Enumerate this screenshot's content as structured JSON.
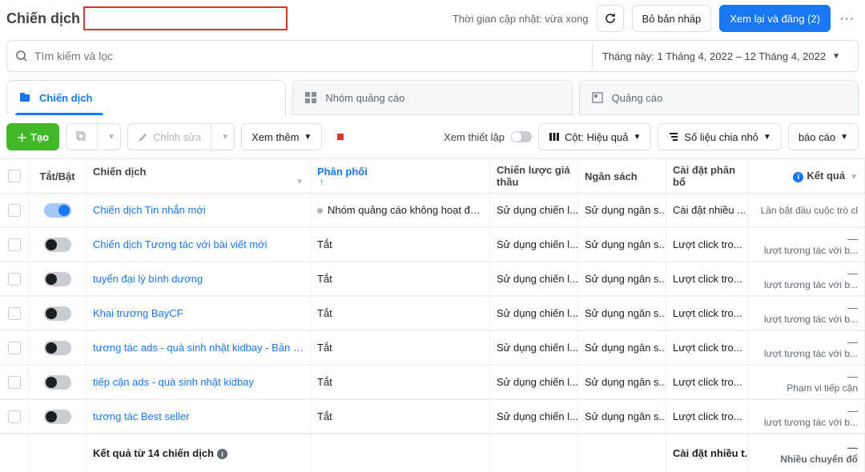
{
  "header": {
    "title": "Chiến dịch",
    "update_text": "Thời gian cập nhật: vừa xong",
    "discard": "Bỏ bản nháp",
    "review": "Xem lại và đăng (2)"
  },
  "search": {
    "placeholder": "Tìm kiếm và lọc",
    "date_range": "Tháng này: 1 Tháng 4, 2022 – 12 Tháng 4, 2022"
  },
  "tabs": {
    "campaigns": "Chiến dịch",
    "adsets": "Nhóm quảng cáo",
    "ads": "Quảng cáo"
  },
  "toolbar": {
    "create": "Tạo",
    "edit": "Chỉnh sửa",
    "more": "Xem thêm",
    "view_setup": "Xem thiết lập",
    "columns": "Cột: Hiệu quả",
    "breakdown": "Số liệu chia nhỏ",
    "reports": "báo cáo"
  },
  "columns": {
    "toggle": "Tắt/Bật",
    "campaign": "Chiến dịch",
    "delivery": "Phân phối",
    "bid": "Chiến lược giá thầu",
    "budget": "Ngân sách",
    "alloc": "Cài đặt phân bổ",
    "results": "Kết quả"
  },
  "rows": [
    {
      "on": true,
      "name": "Chiến dịch Tin nhắn mới",
      "delivery": "Nhóm quảng cáo không hoạt động",
      "dot": true,
      "bid": "Sử dụng chiến l...",
      "budget": "Sử dụng ngân s...",
      "alloc": "Cài đặt nhiều ...",
      "res_main": "",
      "res_sub": "Lần bắt đầu cuộc trò cl"
    },
    {
      "on": false,
      "name": "Chiến dịch Tương tác với bài viết mới",
      "delivery": "Tắt",
      "dot": false,
      "bid": "Sử dụng chiến l...",
      "budget": "Sử dụng ngân s...",
      "alloc": "Lượt click tro...",
      "res_main": "—",
      "res_sub": "lượt tương tác với b..."
    },
    {
      "on": false,
      "name": "tuyển đại lý bình dương",
      "delivery": "Tắt",
      "dot": false,
      "bid": "Sử dụng chiến l...",
      "budget": "Sử dụng ngân s...",
      "alloc": "Lượt click tro...",
      "res_main": "—",
      "res_sub": "lượt tương tác với b..."
    },
    {
      "on": false,
      "name": "Khai trương BayCF",
      "delivery": "Tắt",
      "dot": false,
      "bid": "Sử dụng chiến l...",
      "budget": "Sử dụng ngân s...",
      "alloc": "Lượt click tro...",
      "res_main": "—",
      "res_sub": "lượt tương tác với b..."
    },
    {
      "on": false,
      "name": "tương tác ads - quà sinh nhật kidbay - Bản sao",
      "delivery": "Tắt",
      "dot": false,
      "bid": "Sử dụng chiến l...",
      "budget": "Sử dụng ngân s...",
      "alloc": "Lượt click tro...",
      "res_main": "—",
      "res_sub": "lượt tương tác với b..."
    },
    {
      "on": false,
      "name": "tiếp cận ads - quà sinh nhật kidbay",
      "delivery": "Tắt",
      "dot": false,
      "bid": "Sử dụng chiến l...",
      "budget": "Sử dụng ngân s...",
      "alloc": "Lượt click tro...",
      "res_main": "—",
      "res_sub": "Phạm vi tiếp cận"
    },
    {
      "on": false,
      "name": "tương tác Best seller",
      "delivery": "Tắt",
      "dot": false,
      "bid": "Sử dụng chiến l...",
      "budget": "Sử dụng ngân s...",
      "alloc": "Lượt click tro...",
      "res_main": "—",
      "res_sub": "lượt tương tác với b..."
    }
  ],
  "footer": {
    "summary": "Kết quả từ 14 chiến dịch",
    "alloc": "Cài đặt nhiều t...",
    "res_main": "—",
    "res_sub": "Nhiều chuyển đổ"
  }
}
